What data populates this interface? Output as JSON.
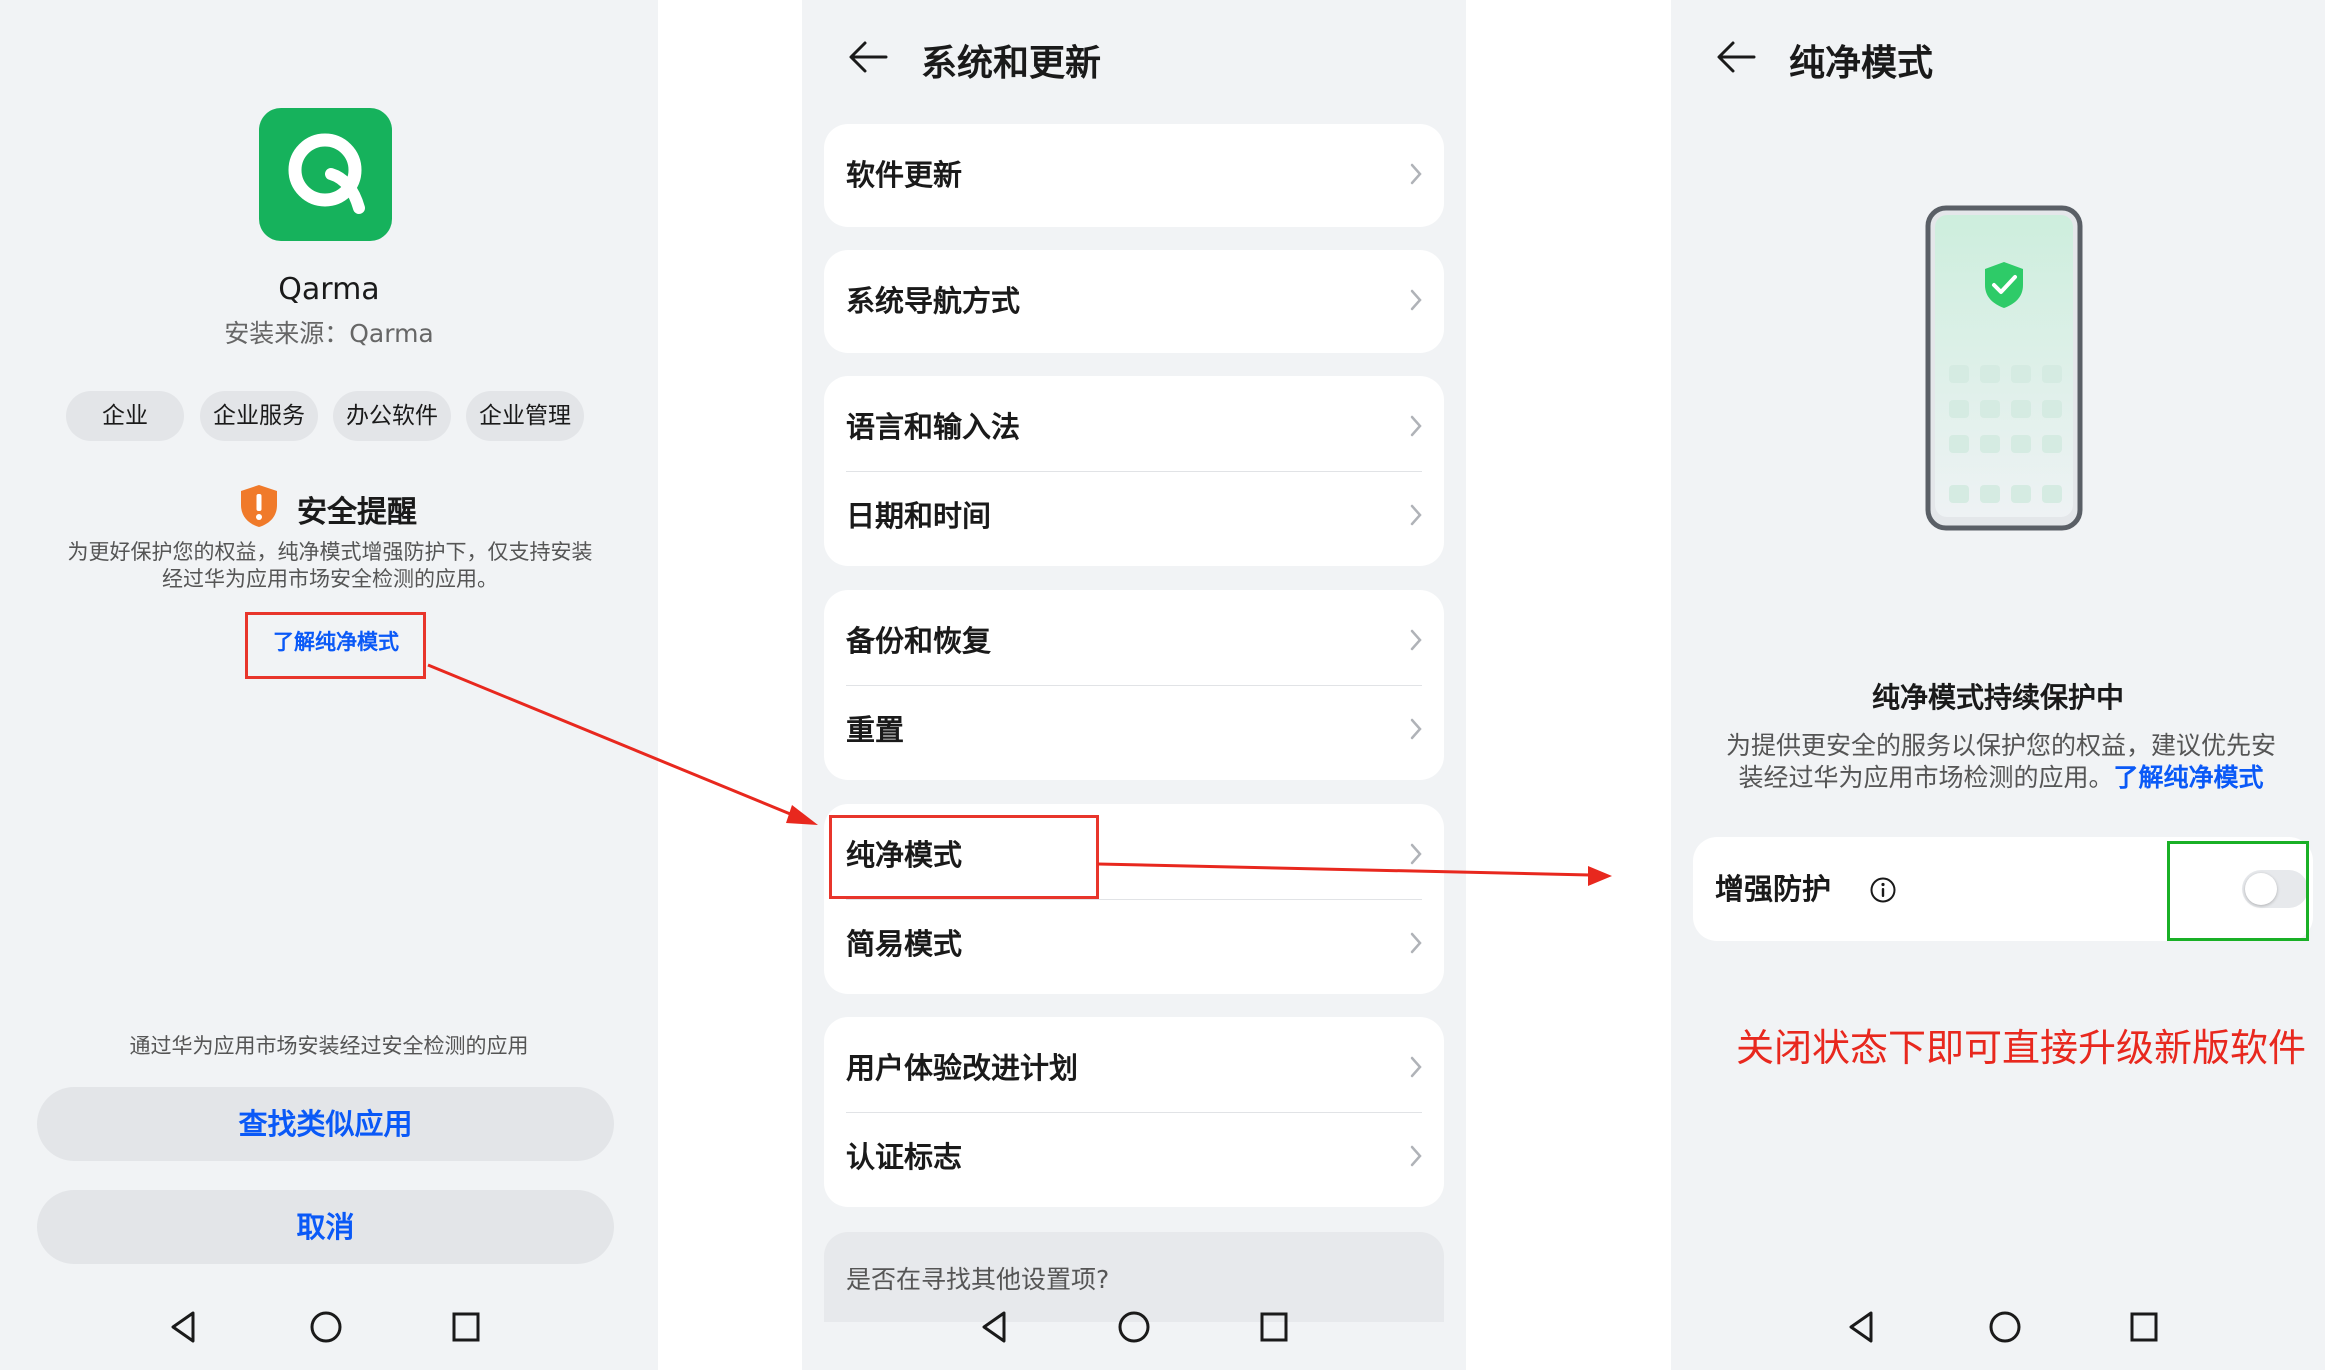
{
  "panel_app": {
    "app_name": "Qarma",
    "install_source": "安装来源：Qarma",
    "tags": [
      "企业",
      "企业服务",
      "办公软件",
      "企业管理"
    ],
    "warning_title": "安全提醒",
    "warning_desc_line1": "为更好保护您的权益，纯净模式增强防护下，仅支持安装",
    "warning_desc_line2": "经过华为应用市场安全检测的应用。",
    "learn_link": "了解纯净模式",
    "bottom_note": "通过华为应用市场安装经过安全检测的应用",
    "find_similar_button": "查找类似应用",
    "cancel_button": "取消"
  },
  "panel_settings": {
    "title": "系统和更新",
    "cards": [
      [
        "软件更新"
      ],
      [
        "系统导航方式"
      ],
      [
        "语言和输入法",
        "日期和时间"
      ],
      [
        "备份和恢复",
        "重置"
      ],
      [
        "纯净模式",
        "简易模式"
      ],
      [
        "用户体验改进计划",
        "认证标志"
      ]
    ],
    "hint": "是否在寻找其他设置项?"
  },
  "panel_pure": {
    "title": "纯净模式",
    "status_title": "纯净模式持续保护中",
    "status_desc_line1": "为提供更安全的服务以保护您的权益，建议优先安",
    "status_desc_line2": "装经过华为应用市场检测的应用。",
    "status_desc_link": "了解纯净模式",
    "toggle_label": "增强防护",
    "toggle_on": false,
    "annotation": "关闭状态下即可直接升级新版软件"
  },
  "colors": {
    "accent": "#0a59f7",
    "highlight_red": "#e8352b",
    "highlight_green": "#19b026",
    "app_icon_green": "#16b25c",
    "warning_orange": "#f07a2a"
  }
}
